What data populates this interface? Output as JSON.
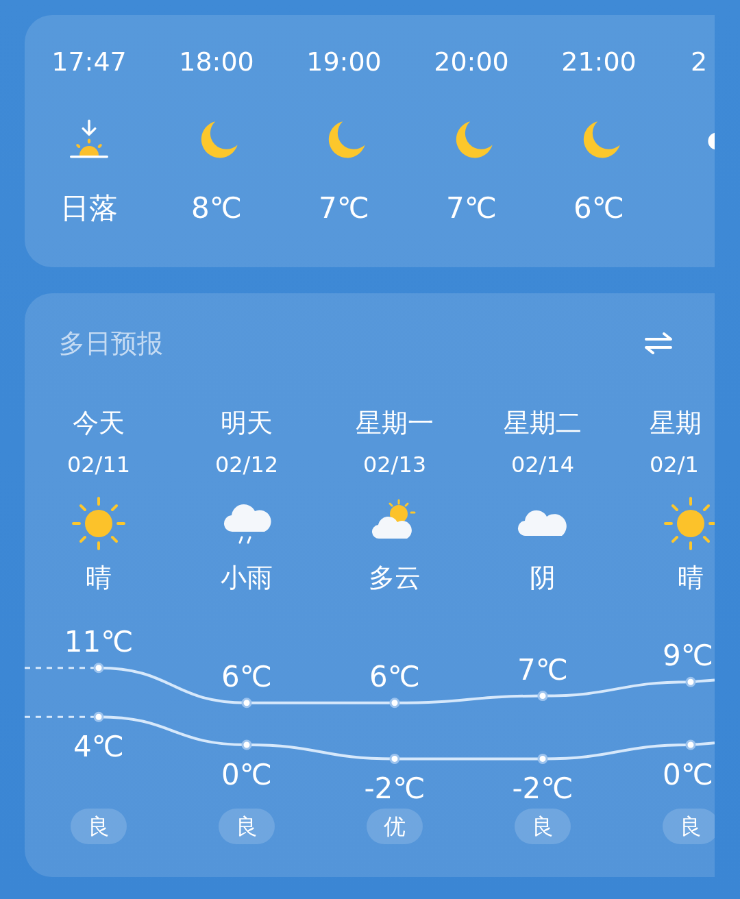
{
  "hourly": [
    {
      "time": "17:47",
      "kind": "sunset",
      "label": "日落"
    },
    {
      "time": "18:00",
      "kind": "moon",
      "label": "8℃"
    },
    {
      "time": "19:00",
      "kind": "moon",
      "label": "7℃"
    },
    {
      "time": "20:00",
      "kind": "moon",
      "label": "7℃"
    },
    {
      "time": "21:00",
      "kind": "moon",
      "label": "6℃"
    },
    {
      "time": "2",
      "kind": "cloudy_moon"
    }
  ],
  "forecast": {
    "title": "多日预报",
    "days": [
      {
        "day": "今天",
        "date": "02/11",
        "kind": "sunny",
        "condition": "晴",
        "high": "11℃",
        "low": "4℃",
        "aqi": "良"
      },
      {
        "day": "明天",
        "date": "02/12",
        "kind": "rain",
        "condition": "小雨",
        "high": "6℃",
        "low": "0℃",
        "aqi": "良"
      },
      {
        "day": "星期一",
        "date": "02/13",
        "kind": "partly_cloudy",
        "condition": "多云",
        "high": "6℃",
        "low": "-2℃",
        "aqi": "优"
      },
      {
        "day": "星期二",
        "date": "02/14",
        "kind": "overcast",
        "condition": "阴",
        "high": "7℃",
        "low": "-2℃",
        "aqi": "良"
      },
      {
        "day": "星期",
        "date": "02/1",
        "kind": "sunny",
        "condition": "晴",
        "high": "9℃",
        "low": "0℃",
        "aqi": "良"
      }
    ]
  }
}
